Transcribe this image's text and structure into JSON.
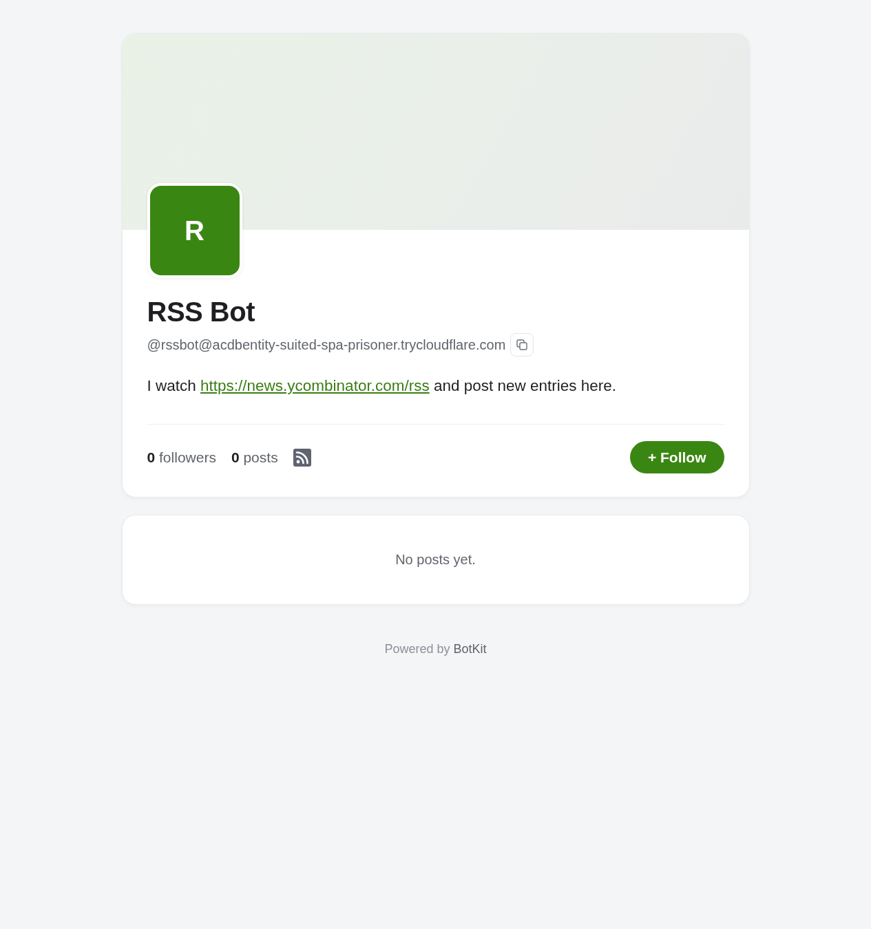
{
  "profile": {
    "avatar": {
      "initial": "R"
    },
    "name": "RSS Bot",
    "handle": "@rssbot@acdbentity-suited-spa-prisoner.trycloudflare.com",
    "bio": {
      "before": "I watch ",
      "link": "https://news.ycombinator.com/rss",
      "after": " and post new entries here."
    },
    "stats": [
      {
        "count": "0",
        "label": "followers"
      },
      {
        "count": "0",
        "label": "posts"
      }
    ],
    "follow_button": {
      "label": "+ Follow"
    }
  },
  "posts": {
    "empty_message": "No posts yet."
  },
  "footer": {
    "prefix": "Powered by ",
    "link": "BotKit"
  }
}
